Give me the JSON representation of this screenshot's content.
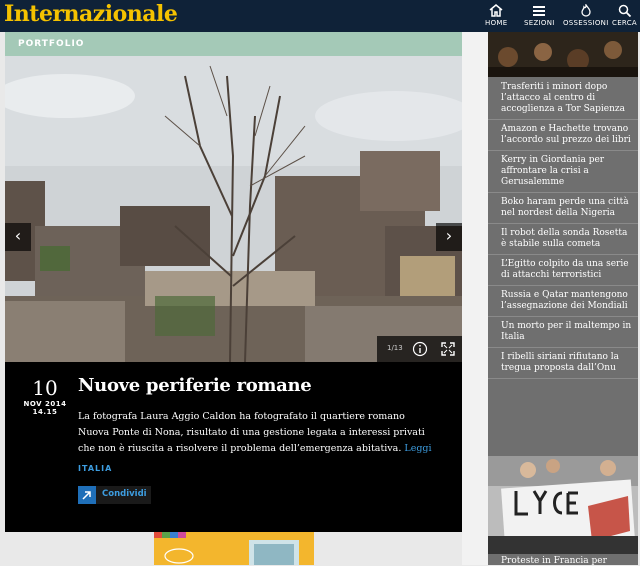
{
  "header": {
    "logo": "Internazionale",
    "nav": [
      {
        "label": "HOME",
        "icon": "home-icon"
      },
      {
        "label": "SEZIONI",
        "icon": "menu-icon"
      },
      {
        "label": "OSSESSIONI",
        "icon": "flame-icon"
      },
      {
        "label": "CERCA",
        "icon": "search-icon"
      }
    ]
  },
  "main": {
    "section_label": "PORTFOLIO",
    "photo_counter": "1/13",
    "date_day": "10",
    "date_month": "NOV 2014",
    "date_time": "14.15",
    "headline": "Nuove periferie romane",
    "summary": "La fotografa Laura Aggio Caldon ha fotografato il quartiere romano Nuova Ponte di Nona, risultato di una gestione legata a interessi privati che non è riuscita a risolvere il problema dell’emergenza abitativa.",
    "read_more": "Leggi",
    "tag": "ITALIA",
    "share_label": "Condividi"
  },
  "sidebar": {
    "items": [
      "Trasferiti i minori dopo l’attacco al centro di accoglienza a Tor Sapienza",
      "Amazon e Hachette trovano l’accordo sul prezzo dei libri",
      "Kerry in Giordania per affrontare la crisi a Gerusalemme",
      "Boko haram perde una città nel nordest della Nigeria",
      "Il robot della sonda Rosetta è stabile sulla cometa",
      "L’Egitto colpito da una serie di attacchi terroristici",
      "Russia e Qatar mantengono l’assegnazione dei Mondiali",
      "Un morto per il maltempo in Italia",
      "I ribelli siriani rifiutano la tregua proposta dall’Onu"
    ],
    "bottom_text": "Proteste in Francia per"
  },
  "colors": {
    "topbar": "#0f2238",
    "logo": "#f5c200",
    "portfolio": "#a4c9b7",
    "link": "#3d9de0",
    "sidebar": "#6f6f6f"
  }
}
